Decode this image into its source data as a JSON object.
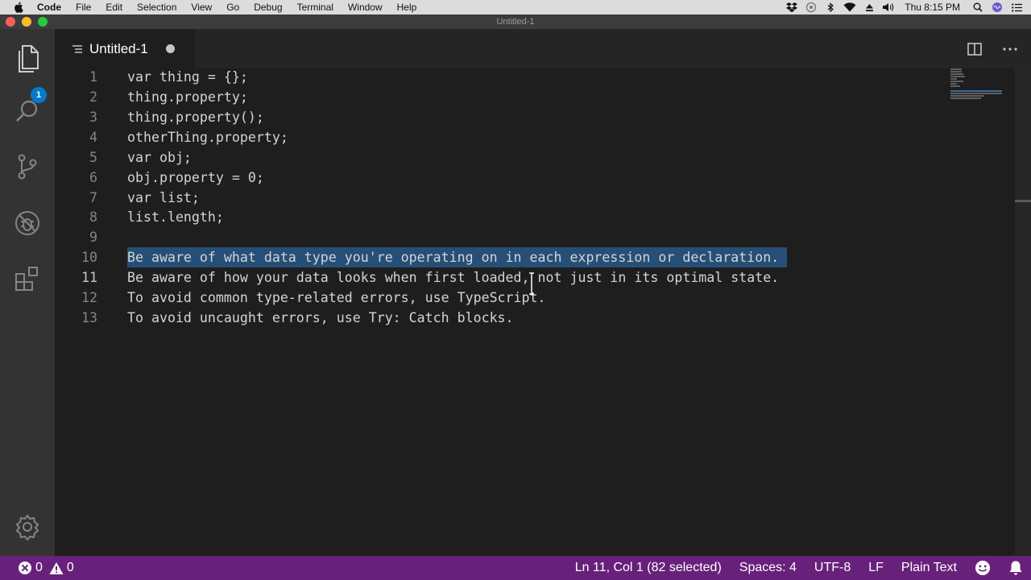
{
  "menubar": {
    "app_name": "Code",
    "items": [
      "File",
      "Edit",
      "Selection",
      "View",
      "Go",
      "Debug",
      "Terminal",
      "Window",
      "Help"
    ],
    "clock": "Thu 8:15 PM"
  },
  "window": {
    "title": "Untitled-1"
  },
  "activitybar": {
    "explorer_badge": "1"
  },
  "tab": {
    "label": "Untitled-1",
    "modified": true
  },
  "editor": {
    "active_line": 11,
    "selected_line": 10,
    "lines": [
      {
        "number": "1",
        "text": "var thing = {};"
      },
      {
        "number": "2",
        "text": "thing.property;"
      },
      {
        "number": "3",
        "text": "thing.property();"
      },
      {
        "number": "4",
        "text": "otherThing.property;"
      },
      {
        "number": "5",
        "text": "var obj;"
      },
      {
        "number": "6",
        "text": "obj.property = 0;"
      },
      {
        "number": "7",
        "text": "var list;"
      },
      {
        "number": "8",
        "text": "list.length;"
      },
      {
        "number": "9",
        "text": ""
      },
      {
        "number": "10",
        "text": "Be aware of what data type you're operating on in each expression or declaration."
      },
      {
        "number": "11",
        "text": "Be aware of how your data looks when first loaded, not just in its optimal state."
      },
      {
        "number": "12",
        "text": "To avoid common type-related errors, use TypeScript."
      },
      {
        "number": "13",
        "text": "To avoid uncaught errors, use Try: Catch blocks."
      }
    ]
  },
  "statusbar": {
    "errors": "0",
    "warnings": "0",
    "cursor": "Ln 11, Col 1 (82 selected)",
    "indent": "Spaces: 4",
    "encoding": "UTF-8",
    "eol": "LF",
    "language": "Plain Text"
  },
  "colors": {
    "statusbar_bg": "#68217a",
    "selection": "#264f78",
    "badge": "#007acc",
    "editor_bg": "#1e1e1e"
  },
  "icons": {
    "activitybar": [
      "files-icon",
      "search-icon",
      "source-control-icon",
      "debug-icon",
      "extensions-icon",
      "settings-gear-icon"
    ],
    "statusbar": [
      "error-icon",
      "warning-icon",
      "feedback-smiley-icon",
      "notifications-bell-icon"
    ]
  }
}
